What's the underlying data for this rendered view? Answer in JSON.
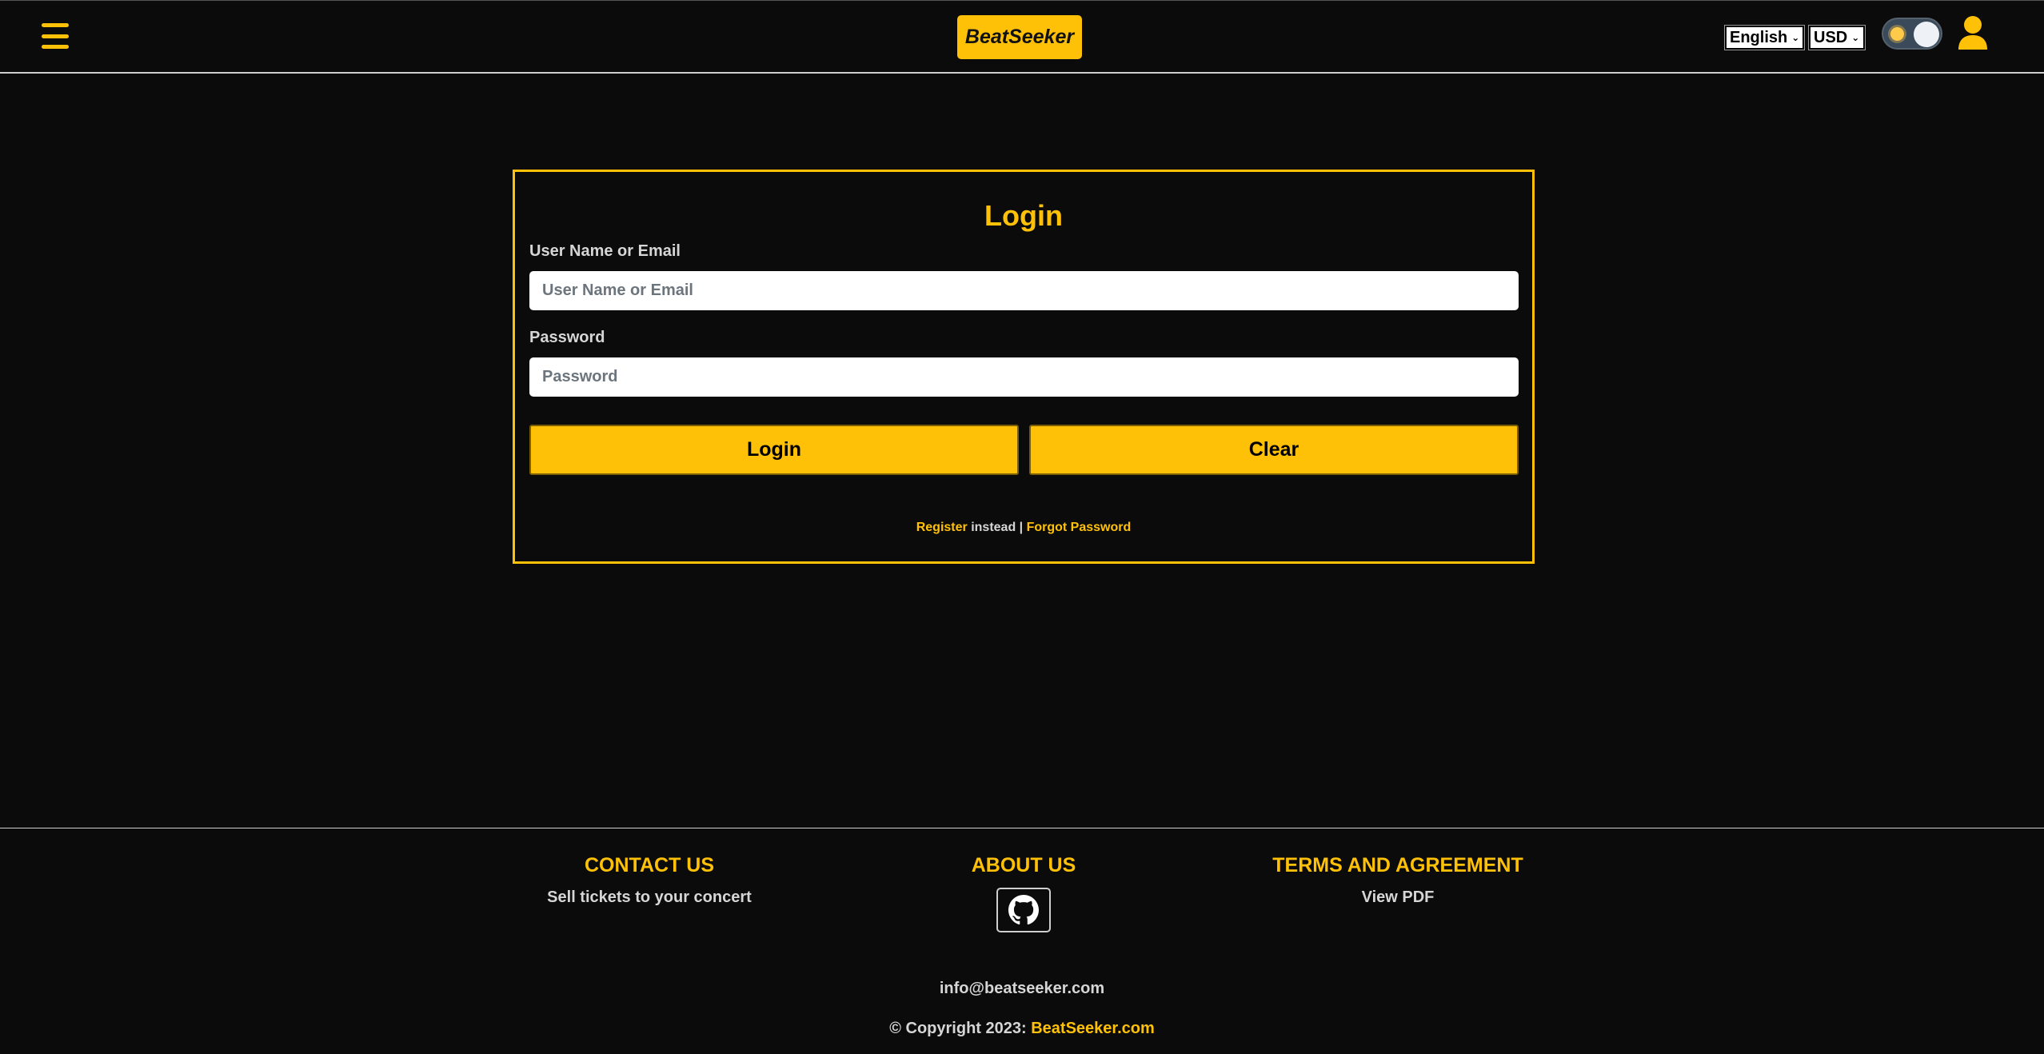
{
  "header": {
    "menu_icon": "hamburger-menu-icon",
    "logo": "BeatSeeker",
    "language": "English",
    "currency": "USD",
    "theme_toggle_icon": "sun-icon",
    "user_icon": "user-icon"
  },
  "login": {
    "title": "Login",
    "username_label": "User Name or Email",
    "username_placeholder": "User Name or Email",
    "username_value": "",
    "password_label": "Password",
    "password_placeholder": "Password",
    "password_value": "",
    "login_button": "Login",
    "clear_button": "Clear",
    "register_link": "Register",
    "instead_text": " instead | ",
    "forgot_link": "Forgot Password"
  },
  "footer": {
    "contact": {
      "heading": "CONTACT US",
      "text": "Sell tickets to your concert"
    },
    "about": {
      "heading": "ABOUT US",
      "icon": "github-icon"
    },
    "terms": {
      "heading": "TERMS AND AGREEMENT",
      "text": "View PDF"
    },
    "email": "info@beatseeker.com",
    "copyright_prefix": "© Copyright 2023: ",
    "copyright_link": "BeatSeeker.com"
  },
  "colors": {
    "accent": "#ffc107",
    "background": "#0b0b0b",
    "text": "#d6d6d6"
  }
}
